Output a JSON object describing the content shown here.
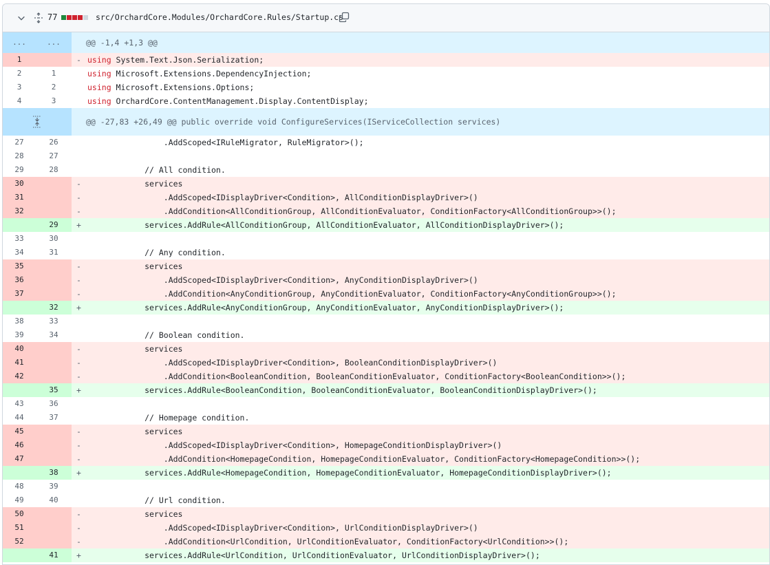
{
  "file_header": {
    "changes_count": "77",
    "path": "src/OrchardCore.Modules/OrchardCore.Rules/Startup.cs",
    "icons": {
      "collapse": "chevron-down-icon",
      "expand": "unfold-icon",
      "copy": "copy-icon"
    },
    "diffstat": [
      "add",
      "del",
      "del",
      "del",
      "neutral"
    ],
    "colors": {
      "add": "#1f883d",
      "del": "#cf222e",
      "neutral": "#d0d7de"
    }
  },
  "hunks": [
    {
      "header": {
        "old": "...",
        "new": "...",
        "text": "@@ -1,4 +1,3 @@"
      },
      "lines": [
        {
          "type": "del",
          "old": "1",
          "new": "",
          "marker": "-",
          "keyword": "using",
          "code": " System.Text.Json.Serialization;"
        },
        {
          "type": "ctx",
          "old": "2",
          "new": "1",
          "marker": "",
          "keyword": "using",
          "code": " Microsoft.Extensions.DependencyInjection;"
        },
        {
          "type": "ctx",
          "old": "3",
          "new": "2",
          "marker": "",
          "keyword": "using",
          "code": " Microsoft.Extensions.Options;"
        },
        {
          "type": "ctx",
          "old": "4",
          "new": "3",
          "marker": "",
          "keyword": "using",
          "code": " OrchardCore.ContentManagement.Display.ContentDisplay;"
        }
      ]
    },
    {
      "header": {
        "text": "@@ -27,83 +26,49 @@ public override void ConfigureServices(IServiceCollection services)"
      },
      "lines": [
        {
          "type": "ctx",
          "old": "27",
          "new": "26",
          "marker": "",
          "keyword": "",
          "code": "                .AddScoped<IRuleMigrator, RuleMigrator>();"
        },
        {
          "type": "ctx",
          "old": "28",
          "new": "27",
          "marker": "",
          "keyword": "",
          "code": ""
        },
        {
          "type": "ctx",
          "old": "29",
          "new": "28",
          "marker": "",
          "keyword": "",
          "code": "            // All condition."
        },
        {
          "type": "del",
          "old": "30",
          "new": "",
          "marker": "-",
          "keyword": "",
          "code": "            services"
        },
        {
          "type": "del",
          "old": "31",
          "new": "",
          "marker": "-",
          "keyword": "",
          "code": "                .AddScoped<IDisplayDriver<Condition>, AllConditionDisplayDriver>()"
        },
        {
          "type": "del",
          "old": "32",
          "new": "",
          "marker": "-",
          "keyword": "",
          "code": "                .AddCondition<AllConditionGroup, AllConditionEvaluator, ConditionFactory<AllConditionGroup>>();"
        },
        {
          "type": "add",
          "old": "",
          "new": "29",
          "marker": "+",
          "keyword": "",
          "code": "            services.AddRule<AllConditionGroup, AllConditionEvaluator, AllConditionDisplayDriver>();"
        },
        {
          "type": "ctx",
          "old": "33",
          "new": "30",
          "marker": "",
          "keyword": "",
          "code": ""
        },
        {
          "type": "ctx",
          "old": "34",
          "new": "31",
          "marker": "",
          "keyword": "",
          "code": "            // Any condition."
        },
        {
          "type": "del",
          "old": "35",
          "new": "",
          "marker": "-",
          "keyword": "",
          "code": "            services"
        },
        {
          "type": "del",
          "old": "36",
          "new": "",
          "marker": "-",
          "keyword": "",
          "code": "                .AddScoped<IDisplayDriver<Condition>, AnyConditionDisplayDriver>()"
        },
        {
          "type": "del",
          "old": "37",
          "new": "",
          "marker": "-",
          "keyword": "",
          "code": "                .AddCondition<AnyConditionGroup, AnyConditionEvaluator, ConditionFactory<AnyConditionGroup>>();"
        },
        {
          "type": "add",
          "old": "",
          "new": "32",
          "marker": "+",
          "keyword": "",
          "code": "            services.AddRule<AnyConditionGroup, AnyConditionEvaluator, AnyConditionDisplayDriver>();"
        },
        {
          "type": "ctx",
          "old": "38",
          "new": "33",
          "marker": "",
          "keyword": "",
          "code": ""
        },
        {
          "type": "ctx",
          "old": "39",
          "new": "34",
          "marker": "",
          "keyword": "",
          "code": "            // Boolean condition."
        },
        {
          "type": "del",
          "old": "40",
          "new": "",
          "marker": "-",
          "keyword": "",
          "code": "            services"
        },
        {
          "type": "del",
          "old": "41",
          "new": "",
          "marker": "-",
          "keyword": "",
          "code": "                .AddScoped<IDisplayDriver<Condition>, BooleanConditionDisplayDriver>()"
        },
        {
          "type": "del",
          "old": "42",
          "new": "",
          "marker": "-",
          "keyword": "",
          "code": "                .AddCondition<BooleanCondition, BooleanConditionEvaluator, ConditionFactory<BooleanCondition>>();"
        },
        {
          "type": "add",
          "old": "",
          "new": "35",
          "marker": "+",
          "keyword": "",
          "code": "            services.AddRule<BooleanCondition, BooleanConditionEvaluator, BooleanConditionDisplayDriver>();"
        },
        {
          "type": "ctx",
          "old": "43",
          "new": "36",
          "marker": "",
          "keyword": "",
          "code": ""
        },
        {
          "type": "ctx",
          "old": "44",
          "new": "37",
          "marker": "",
          "keyword": "",
          "code": "            // Homepage condition."
        },
        {
          "type": "del",
          "old": "45",
          "new": "",
          "marker": "-",
          "keyword": "",
          "code": "            services"
        },
        {
          "type": "del",
          "old": "46",
          "new": "",
          "marker": "-",
          "keyword": "",
          "code": "                .AddScoped<IDisplayDriver<Condition>, HomepageConditionDisplayDriver>()"
        },
        {
          "type": "del",
          "old": "47",
          "new": "",
          "marker": "-",
          "keyword": "",
          "code": "                .AddCondition<HomepageCondition, HomepageConditionEvaluator, ConditionFactory<HomepageCondition>>();"
        },
        {
          "type": "add",
          "old": "",
          "new": "38",
          "marker": "+",
          "keyword": "",
          "code": "            services.AddRule<HomepageCondition, HomepageConditionEvaluator, HomepageConditionDisplayDriver>();"
        },
        {
          "type": "ctx",
          "old": "48",
          "new": "39",
          "marker": "",
          "keyword": "",
          "code": ""
        },
        {
          "type": "ctx",
          "old": "49",
          "new": "40",
          "marker": "",
          "keyword": "",
          "code": "            // Url condition."
        },
        {
          "type": "del",
          "old": "50",
          "new": "",
          "marker": "-",
          "keyword": "",
          "code": "            services"
        },
        {
          "type": "del",
          "old": "51",
          "new": "",
          "marker": "-",
          "keyword": "",
          "code": "                .AddScoped<IDisplayDriver<Condition>, UrlConditionDisplayDriver>()"
        },
        {
          "type": "del",
          "old": "52",
          "new": "",
          "marker": "-",
          "keyword": "",
          "code": "                .AddCondition<UrlCondition, UrlConditionEvaluator, ConditionFactory<UrlCondition>>();"
        },
        {
          "type": "add",
          "old": "",
          "new": "41",
          "marker": "+",
          "keyword": "",
          "code": "            services.AddRule<UrlCondition, UrlConditionEvaluator, UrlConditionDisplayDriver>();"
        }
      ]
    }
  ]
}
